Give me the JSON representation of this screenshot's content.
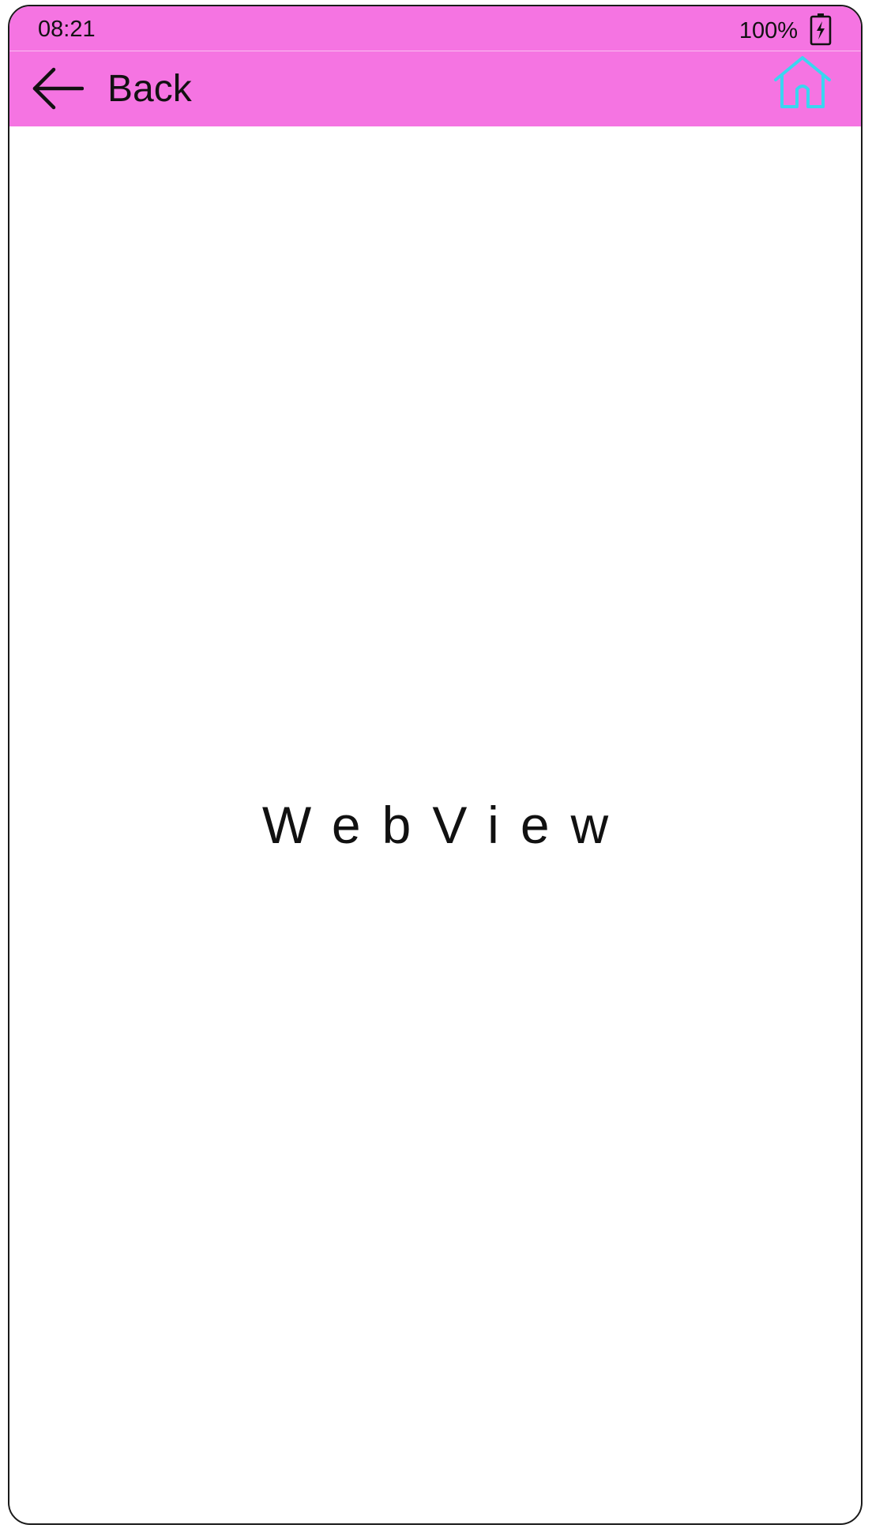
{
  "status_bar": {
    "time": "08:21",
    "battery_percent": "100%",
    "battery_icon": "battery-charging-icon",
    "background_color": "#f574e2"
  },
  "toolbar": {
    "back_label": "Back",
    "back_icon": "arrow-left-icon",
    "home_icon": "home-icon",
    "home_icon_color": "#3ad6f0",
    "background_color": "#f574e2"
  },
  "content": {
    "webview_label": "WebView"
  }
}
